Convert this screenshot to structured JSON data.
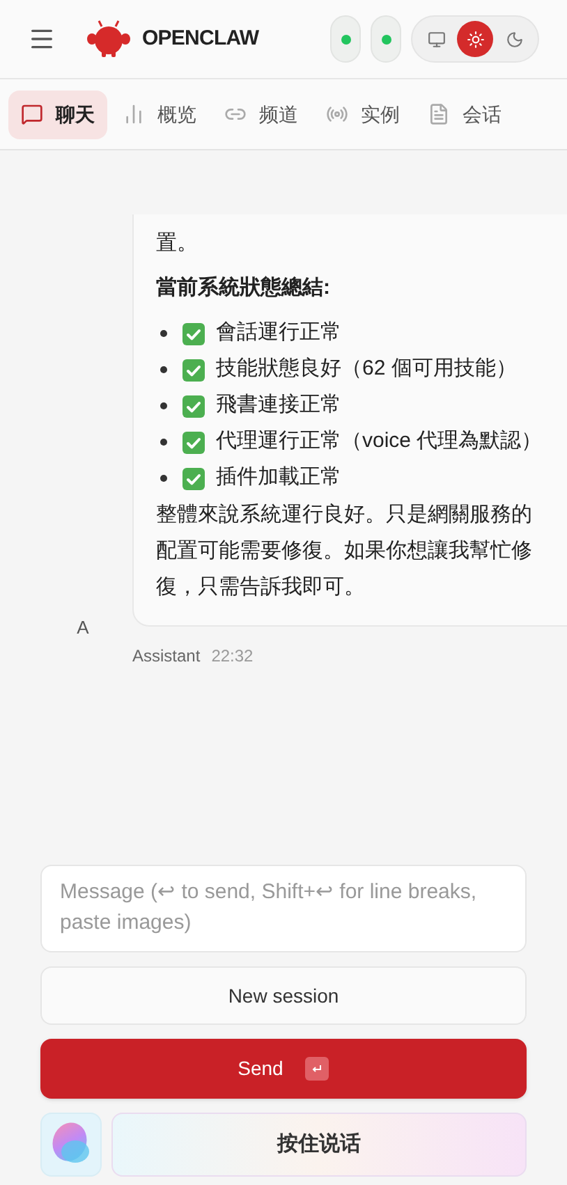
{
  "header": {
    "brand": "OPENCLAW",
    "status_dots": [
      {
        "color": "#22c55e"
      },
      {
        "color": "#22c55e"
      }
    ],
    "theme_options": [
      {
        "kind": "system",
        "selected": false
      },
      {
        "kind": "light",
        "selected": true
      },
      {
        "kind": "dark",
        "selected": false
      }
    ]
  },
  "tabs": [
    {
      "kind": "chat",
      "label": "聊天",
      "selected": true
    },
    {
      "kind": "overview",
      "label": "概览",
      "selected": false
    },
    {
      "kind": "channels",
      "label": "频道",
      "selected": false
    },
    {
      "kind": "instances",
      "label": "实例",
      "selected": false
    },
    {
      "kind": "sessions",
      "label": "会话",
      "selected": false
    }
  ],
  "message": {
    "blocks": [
      {
        "kind": "paragraph",
        "text": "置。"
      },
      {
        "kind": "heading",
        "text": "當前系統狀態總結:"
      },
      {
        "kind": "checklist",
        "items": [
          "會話運行正常",
          "技能狀態良好（62 個可用技能）",
          "飛書連接正常",
          "代理運行正常（voice 代理為默認）",
          "插件加載正常"
        ]
      },
      {
        "kind": "paragraph",
        "text": "整體來說系統運行良好。只是網關服務的配置可能需要修復。如果你想讓我幫忙修復，只需告訴我即可。"
      }
    ],
    "avatar": "A",
    "sender": "Assistant",
    "time": "22:32"
  },
  "composer": {
    "placeholder": "Message (↩ to send, Shift+↩ for line breaks, paste images)",
    "new_session": "New session",
    "send": "Send",
    "voice": "按住说话"
  }
}
